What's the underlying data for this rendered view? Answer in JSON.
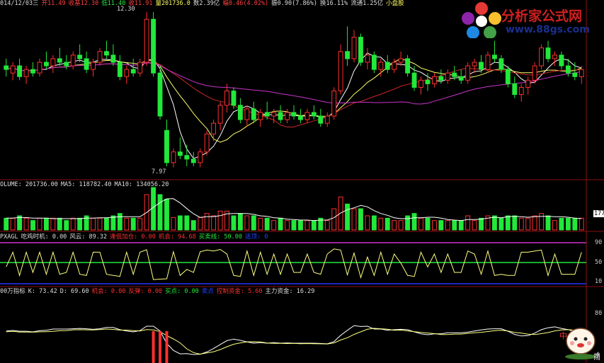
{
  "colors": {
    "up": "#ff3030",
    "down": "#22e83a",
    "ma5": "#ffffff",
    "ma10": "#ffff66",
    "ma20": "#c82828",
    "ma60": "#cc33cc",
    "grid": "#8a1010",
    "yellow": "#ffff80"
  },
  "header": {
    "segments": [
      {
        "text": "014/12/03三",
        "color": "#dddddd"
      },
      {
        "text": "开11.49",
        "color": "#ff4040"
      },
      {
        "text": "收基12.30",
        "color": "#ff4040"
      },
      {
        "text": "低11.40",
        "color": "#22e83a"
      },
      {
        "text": "收11.91",
        "color": "#ff4040"
      },
      {
        "text": "量201736.0",
        "color": "#ffff60"
      },
      {
        "text": "数2.39亿",
        "color": "#dddddd"
      },
      {
        "text": "幅0.46(4.02%)",
        "color": "#ff4040"
      },
      {
        "text": "振0.90(7.86%)",
        "color": "#dddddd"
      },
      {
        "text": "换16.11%",
        "color": "#dddddd"
      },
      {
        "text": "流通1.25亿",
        "color": "#dddddd"
      },
      {
        "text": "小盘股",
        "color": "#ffff60"
      }
    ]
  },
  "price_annotations": {
    "high": "12.30",
    "low": "7.97"
  },
  "volume_header": {
    "segments": [
      {
        "text": "OLUME: 201736.00",
        "color": "#dddddd"
      },
      {
        "text": "MA5: 118782.40",
        "color": "#dddddd"
      },
      {
        "text": "MA10: 134056.20",
        "color": "#dddddd"
      }
    ],
    "right_value": "1777"
  },
  "indicator1_header": {
    "segments": [
      {
        "text": "PXAGL",
        "color": "#dddddd"
      },
      {
        "text": "吃鸡时机: 0.00",
        "color": "#dddddd"
      },
      {
        "text": "风云: 89.32",
        "color": "#dddddd"
      },
      {
        "text": "逢低加仓: 0.00",
        "color": "#ff3030"
      },
      {
        "text": "机会: 94.68",
        "color": "#ff3030"
      },
      {
        "text": "买卖线: 50.00",
        "color": "#22e83a"
      },
      {
        "text": "逃顶: 0",
        "color": "#2244ff"
      }
    ],
    "ticks": [
      "90",
      "50",
      "10"
    ]
  },
  "indicator2_header": {
    "segments": [
      {
        "text": "00万指标",
        "color": "#dddddd"
      },
      {
        "text": "K: 73.42",
        "color": "#dddddd"
      },
      {
        "text": "D: 69.60",
        "color": "#dddddd"
      },
      {
        "text": "机会: 0.00",
        "color": "#ff3030"
      },
      {
        "text": "反弹: 0.00",
        "color": "#ff3030"
      },
      {
        "text": "买点: 0.00",
        "color": "#22e83a"
      },
      {
        "text": "卖点",
        "color": "#2244ff"
      },
      {
        "text": "控制资金: 5.60",
        "color": "#ff3030"
      },
      {
        "text": "主力资金: 16.29",
        "color": "#dddddd"
      }
    ],
    "ticks": [
      "80",
      "0"
    ]
  },
  "logo": {
    "title": "分析家公式网",
    "url": "www.88gs.com",
    "mascot_left": "中",
    "mascot_right": "简"
  },
  "chart_data": {
    "type": "candlestick",
    "title": "",
    "candles": [
      {
        "o": 10.8,
        "h": 11.0,
        "l": 10.5,
        "c": 10.7
      },
      {
        "o": 10.6,
        "h": 10.9,
        "l": 10.4,
        "c": 10.8
      },
      {
        "o": 10.8,
        "h": 11.0,
        "l": 10.4,
        "c": 10.5
      },
      {
        "o": 10.5,
        "h": 10.8,
        "l": 10.3,
        "c": 10.7
      },
      {
        "o": 10.7,
        "h": 10.9,
        "l": 10.5,
        "c": 10.6
      },
      {
        "o": 10.6,
        "h": 11.0,
        "l": 10.5,
        "c": 10.9
      },
      {
        "o": 10.9,
        "h": 11.2,
        "l": 10.7,
        "c": 10.8
      },
      {
        "o": 10.8,
        "h": 11.1,
        "l": 10.6,
        "c": 11.0
      },
      {
        "o": 11.0,
        "h": 11.3,
        "l": 10.8,
        "c": 10.9
      },
      {
        "o": 10.9,
        "h": 11.1,
        "l": 10.7,
        "c": 10.8
      },
      {
        "o": 10.8,
        "h": 11.2,
        "l": 10.7,
        "c": 11.1
      },
      {
        "o": 11.1,
        "h": 11.4,
        "l": 10.9,
        "c": 11.0
      },
      {
        "o": 11.0,
        "h": 11.2,
        "l": 10.6,
        "c": 10.7
      },
      {
        "o": 10.7,
        "h": 11.0,
        "l": 10.5,
        "c": 10.9
      },
      {
        "o": 10.9,
        "h": 11.3,
        "l": 10.8,
        "c": 11.2
      },
      {
        "o": 11.2,
        "h": 11.5,
        "l": 11.0,
        "c": 11.1
      },
      {
        "o": 11.1,
        "h": 11.4,
        "l": 10.8,
        "c": 10.9
      },
      {
        "o": 10.9,
        "h": 11.1,
        "l": 10.4,
        "c": 10.5
      },
      {
        "o": 10.5,
        "h": 10.8,
        "l": 10.3,
        "c": 10.7
      },
      {
        "o": 10.7,
        "h": 11.0,
        "l": 10.5,
        "c": 10.6
      },
      {
        "o": 10.6,
        "h": 11.0,
        "l": 10.5,
        "c": 10.9
      },
      {
        "o": 10.9,
        "h": 12.3,
        "l": 10.8,
        "c": 12.1
      },
      {
        "o": 12.1,
        "h": 12.3,
        "l": 10.5,
        "c": 10.6
      },
      {
        "o": 10.6,
        "h": 10.8,
        "l": 9.3,
        "c": 9.4
      },
      {
        "o": 9.0,
        "h": 9.3,
        "l": 8.0,
        "c": 8.1
      },
      {
        "o": 8.1,
        "h": 8.5,
        "l": 7.97,
        "c": 8.4
      },
      {
        "o": 8.4,
        "h": 8.8,
        "l": 8.2,
        "c": 8.3
      },
      {
        "o": 8.3,
        "h": 8.6,
        "l": 8.0,
        "c": 8.2
      },
      {
        "o": 8.2,
        "h": 8.4,
        "l": 8.0,
        "c": 8.1
      },
      {
        "o": 8.1,
        "h": 8.5,
        "l": 7.97,
        "c": 8.4
      },
      {
        "o": 8.4,
        "h": 9.0,
        "l": 8.3,
        "c": 8.9
      },
      {
        "o": 8.9,
        "h": 9.3,
        "l": 8.7,
        "c": 9.2
      },
      {
        "o": 9.2,
        "h": 9.8,
        "l": 9.0,
        "c": 9.7
      },
      {
        "o": 9.7,
        "h": 10.3,
        "l": 9.5,
        "c": 10.1
      },
      {
        "o": 10.1,
        "h": 10.2,
        "l": 9.6,
        "c": 9.7
      },
      {
        "o": 9.7,
        "h": 9.9,
        "l": 9.2,
        "c": 9.3
      },
      {
        "o": 9.3,
        "h": 9.7,
        "l": 9.1,
        "c": 9.6
      },
      {
        "o": 9.6,
        "h": 9.8,
        "l": 9.2,
        "c": 9.3
      },
      {
        "o": 9.3,
        "h": 9.6,
        "l": 9.1,
        "c": 9.5
      },
      {
        "o": 9.5,
        "h": 9.8,
        "l": 9.3,
        "c": 9.4
      },
      {
        "o": 9.4,
        "h": 9.6,
        "l": 9.2,
        "c": 9.5
      },
      {
        "o": 9.5,
        "h": 9.7,
        "l": 9.2,
        "c": 9.3
      },
      {
        "o": 9.3,
        "h": 9.6,
        "l": 9.2,
        "c": 9.5
      },
      {
        "o": 9.5,
        "h": 9.7,
        "l": 9.3,
        "c": 9.4
      },
      {
        "o": 9.4,
        "h": 9.6,
        "l": 9.2,
        "c": 9.3
      },
      {
        "o": 9.3,
        "h": 9.6,
        "l": 9.2,
        "c": 9.5
      },
      {
        "o": 9.5,
        "h": 9.7,
        "l": 9.3,
        "c": 9.4
      },
      {
        "o": 9.4,
        "h": 9.6,
        "l": 9.1,
        "c": 9.2
      },
      {
        "o": 9.2,
        "h": 9.5,
        "l": 9.1,
        "c": 9.4
      },
      {
        "o": 9.4,
        "h": 10.2,
        "l": 9.3,
        "c": 10.1
      },
      {
        "o": 10.1,
        "h": 11.4,
        "l": 10.0,
        "c": 11.2
      },
      {
        "o": 11.2,
        "h": 11.9,
        "l": 10.8,
        "c": 11.0
      },
      {
        "o": 11.0,
        "h": 11.8,
        "l": 10.9,
        "c": 11.6
      },
      {
        "o": 11.6,
        "h": 11.7,
        "l": 10.8,
        "c": 10.9
      },
      {
        "o": 10.9,
        "h": 11.3,
        "l": 10.7,
        "c": 11.1
      },
      {
        "o": 11.1,
        "h": 11.2,
        "l": 10.6,
        "c": 10.7
      },
      {
        "o": 10.7,
        "h": 11.0,
        "l": 10.5,
        "c": 10.9
      },
      {
        "o": 10.9,
        "h": 11.1,
        "l": 10.6,
        "c": 10.7
      },
      {
        "o": 10.7,
        "h": 11.0,
        "l": 10.6,
        "c": 10.9
      },
      {
        "o": 10.9,
        "h": 11.2,
        "l": 10.8,
        "c": 11.0
      },
      {
        "o": 11.0,
        "h": 11.1,
        "l": 10.5,
        "c": 10.6
      },
      {
        "o": 10.6,
        "h": 10.8,
        "l": 10.1,
        "c": 10.2
      },
      {
        "o": 10.2,
        "h": 10.5,
        "l": 10.0,
        "c": 10.4
      },
      {
        "o": 10.4,
        "h": 10.6,
        "l": 10.1,
        "c": 10.3
      },
      {
        "o": 10.3,
        "h": 10.6,
        "l": 10.2,
        "c": 10.5
      },
      {
        "o": 10.5,
        "h": 10.7,
        "l": 10.3,
        "c": 10.4
      },
      {
        "o": 10.4,
        "h": 10.7,
        "l": 10.3,
        "c": 10.6
      },
      {
        "o": 10.6,
        "h": 10.8,
        "l": 10.4,
        "c": 10.5
      },
      {
        "o": 10.5,
        "h": 10.7,
        "l": 10.3,
        "c": 10.4
      },
      {
        "o": 10.4,
        "h": 10.9,
        "l": 10.3,
        "c": 10.8
      },
      {
        "o": 10.8,
        "h": 11.0,
        "l": 10.6,
        "c": 10.9
      },
      {
        "o": 10.9,
        "h": 11.1,
        "l": 10.6,
        "c": 10.7
      },
      {
        "o": 10.7,
        "h": 11.2,
        "l": 10.6,
        "c": 11.1
      },
      {
        "o": 11.1,
        "h": 11.5,
        "l": 10.9,
        "c": 11.0
      },
      {
        "o": 11.0,
        "h": 11.1,
        "l": 10.6,
        "c": 10.7
      },
      {
        "o": 10.7,
        "h": 10.8,
        "l": 10.2,
        "c": 10.3
      },
      {
        "o": 10.3,
        "h": 10.5,
        "l": 9.9,
        "c": 10.0
      },
      {
        "o": 10.0,
        "h": 10.3,
        "l": 9.8,
        "c": 10.2
      },
      {
        "o": 10.2,
        "h": 10.5,
        "l": 10.0,
        "c": 10.4
      },
      {
        "o": 10.4,
        "h": 10.9,
        "l": 10.3,
        "c": 10.8
      },
      {
        "o": 10.8,
        "h": 11.4,
        "l": 10.7,
        "c": 11.3
      },
      {
        "o": 11.3,
        "h": 11.5,
        "l": 10.9,
        "c": 11.0
      },
      {
        "o": 11.0,
        "h": 11.2,
        "l": 10.8,
        "c": 11.1
      },
      {
        "o": 11.1,
        "h": 11.2,
        "l": 10.7,
        "c": 10.8
      },
      {
        "o": 10.8,
        "h": 11.0,
        "l": 10.5,
        "c": 10.6
      },
      {
        "o": 10.6,
        "h": 10.9,
        "l": 10.4,
        "c": 10.5
      },
      {
        "o": 10.5,
        "h": 10.8,
        "l": 10.3,
        "c": 10.7
      }
    ]
  }
}
